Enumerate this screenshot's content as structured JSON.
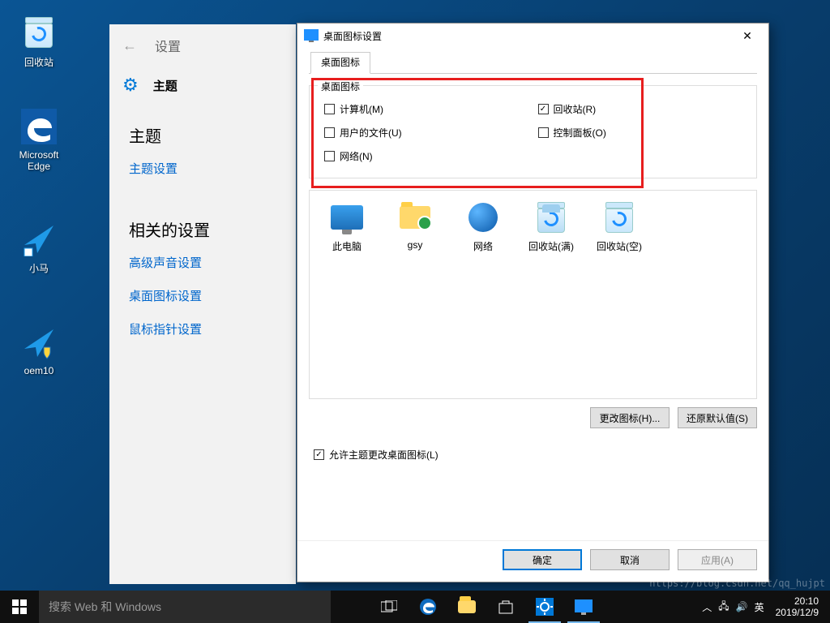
{
  "desktop": {
    "icons": [
      {
        "label": "回收站"
      },
      {
        "label": "Microsoft Edge"
      },
      {
        "label": "小马"
      },
      {
        "label": "oem10"
      }
    ]
  },
  "settings_panel": {
    "back": "←",
    "top_label": "设置",
    "gear_title": "主题",
    "section1": "主题",
    "link_theme_settings": "主题设置",
    "section2": "相关的设置",
    "link_sound": "高级声音设置",
    "link_desktop_icons": "桌面图标设置",
    "link_mouse": "鼠标指针设置"
  },
  "dialog": {
    "title": "桌面图标设置",
    "tab": "桌面图标",
    "group_legend": "桌面图标",
    "checks": {
      "computer": "计算机(M)",
      "recycle": "回收站(R)",
      "userfiles": "用户的文件(U)",
      "control": "控制面板(O)",
      "network": "网络(N)"
    },
    "checked": {
      "computer": false,
      "recycle": true,
      "userfiles": false,
      "control": false,
      "network": false
    },
    "icon_items": [
      {
        "label": "此电脑"
      },
      {
        "label": "gsy"
      },
      {
        "label": "网络"
      },
      {
        "label": "回收站(满)"
      },
      {
        "label": "回收站(空)"
      }
    ],
    "btn_change_icon": "更改图标(H)...",
    "btn_restore": "还原默认值(S)",
    "allow_theme": "允许主题更改桌面图标(L)",
    "allow_theme_checked": true,
    "btn_ok": "确定",
    "btn_cancel": "取消",
    "btn_apply": "应用(A)"
  },
  "taskbar": {
    "search_placeholder": "搜索 Web 和 Windows",
    "clock_time": "20:10",
    "clock_date": "2019/12/9"
  },
  "watermark": "https://blog.csdn.net/qq_hujpt"
}
